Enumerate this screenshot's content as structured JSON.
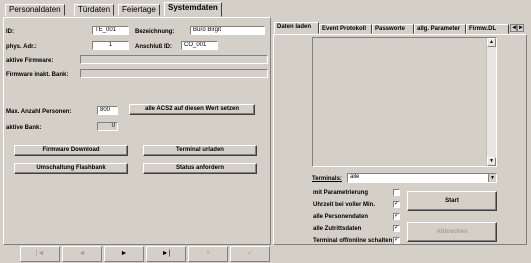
{
  "tabs": [
    {
      "label": "Personaldaten"
    },
    {
      "label": "Türdaten"
    },
    {
      "label": "Feiertage"
    },
    {
      "label": "Systemdaten"
    }
  ],
  "left": {
    "id_label": "ID:",
    "id_value": "TE_001",
    "bezeichnung_label": "Bezeichnung:",
    "bezeichnung_value": "Büro Birgit",
    "phys_label": "phys. Adr.:",
    "phys_value": "1",
    "anschluss_label": "Anschluß ID:",
    "anschluss_value": "CO_001",
    "aktive_fw_label": "aktive Firmware:",
    "aktive_fw_value": "",
    "inakt_fw_label": "Firmware inakt. Bank:",
    "inakt_fw_value": "",
    "max_persons_label": "Max. Anzahl Personen:",
    "max_persons_value": "800",
    "set_all_button": "alle ACS2 auf diesen Wert setzen",
    "aktive_bank_label": "aktive Bank:",
    "aktive_bank_value": "0",
    "firmware_download_button": "Firmware Download",
    "terminal_reload_button": "Terminal urladen",
    "flash_switch_button": "Umschaltung Flashbank",
    "status_button": "Status anfordern"
  },
  "right": {
    "tabs": [
      {
        "label": "Daten laden"
      },
      {
        "label": "Event Protokoll"
      },
      {
        "label": "Passworte"
      },
      {
        "label": "allg. Parameter"
      },
      {
        "label": "Firmw.DL"
      }
    ],
    "terminals_label": "Terminals:",
    "terminals_value": "alle",
    "options": [
      {
        "label": "mit Parametrierung",
        "checked": false
      },
      {
        "label": "Uhrzeit bei voller Min.",
        "checked": true
      },
      {
        "label": "alle Personendaten",
        "checked": true
      },
      {
        "label": "alle Zutrittsdaten",
        "checked": true
      },
      {
        "label": "Terminal off/online schalten",
        "checked": true
      }
    ],
    "start_button": "Start",
    "abort_button": "Abbrechen"
  },
  "toolbar": {
    "buttons": [
      {
        "glyph": "|◄"
      },
      {
        "glyph": "◄"
      },
      {
        "glyph": "►"
      },
      {
        "glyph": "►|"
      },
      {
        "glyph": "+"
      },
      {
        "glyph": "✓"
      }
    ]
  }
}
